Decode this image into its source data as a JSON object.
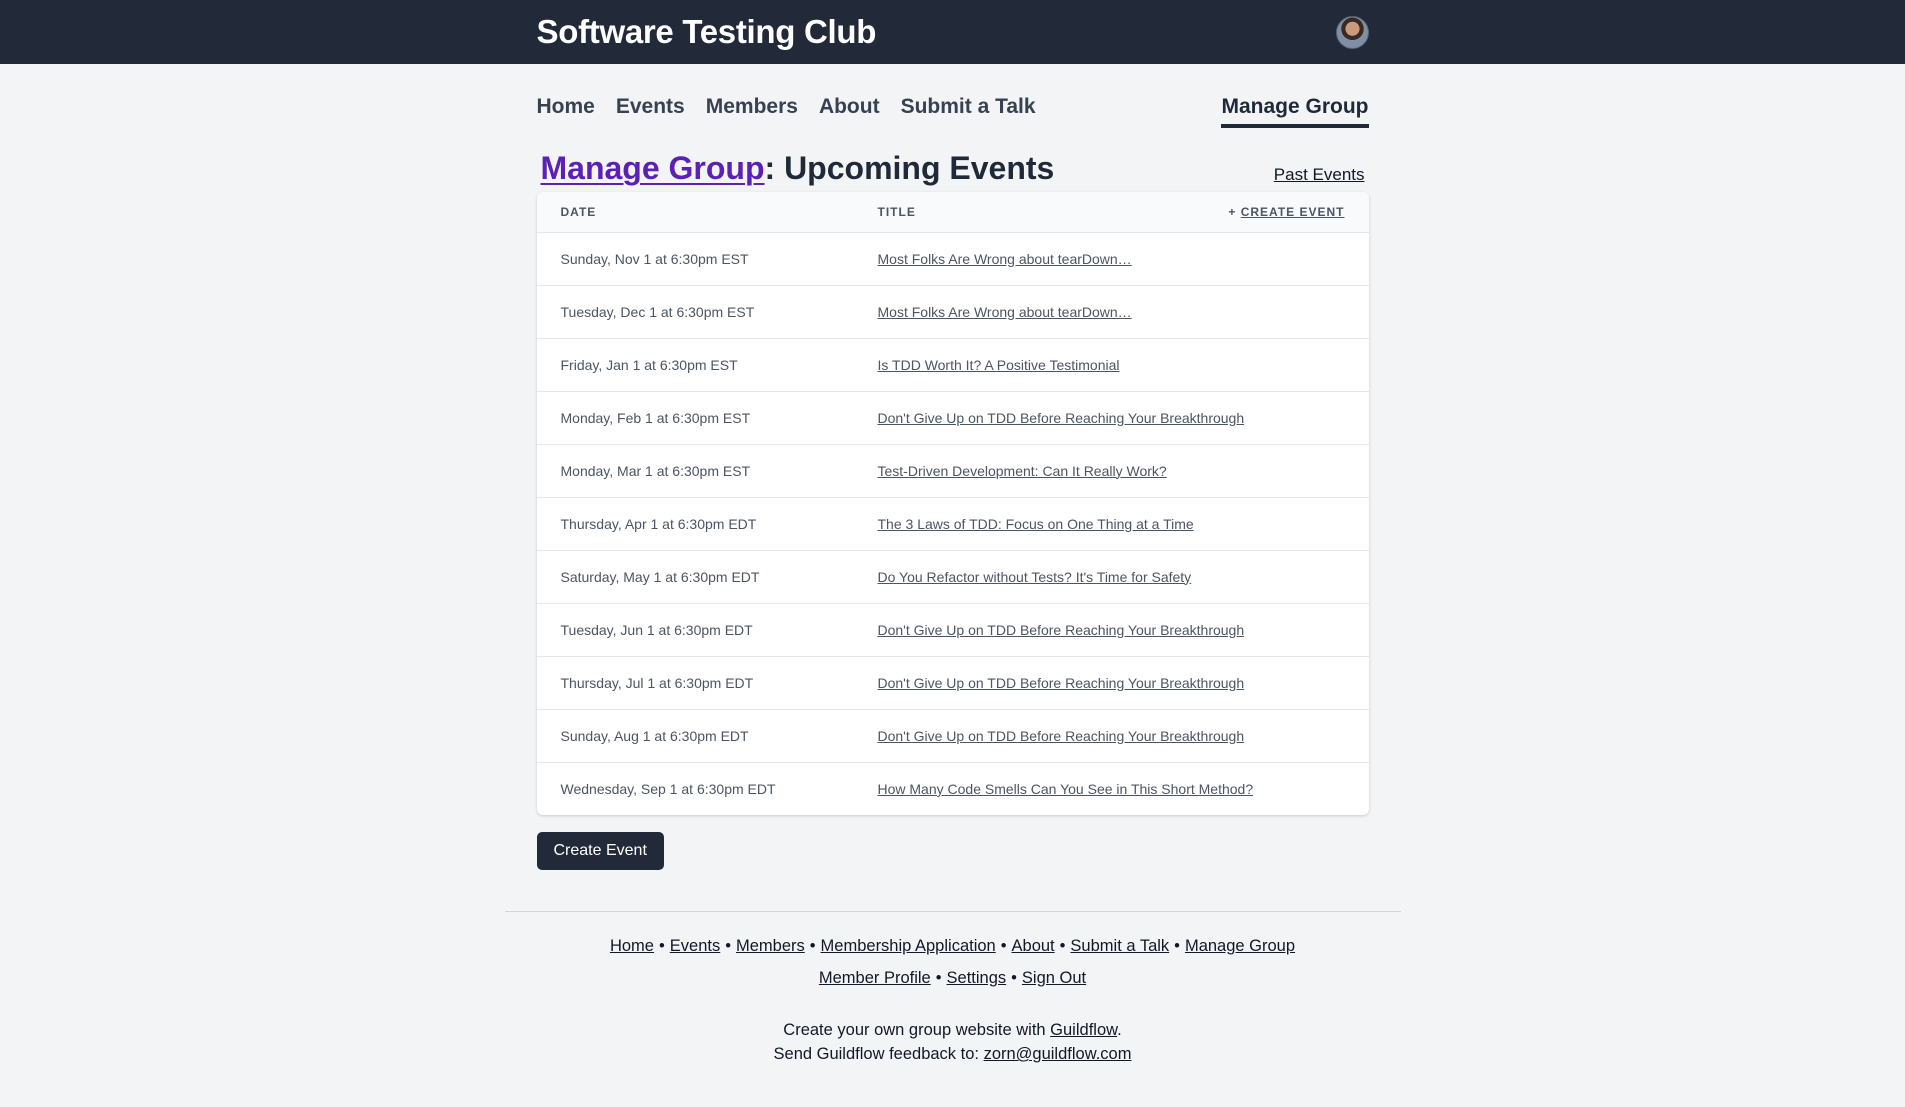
{
  "header": {
    "site_title": "Software Testing Club",
    "avatar_icon": "user-avatar"
  },
  "nav": {
    "items": [
      {
        "label": "Home"
      },
      {
        "label": "Events"
      },
      {
        "label": "Members"
      },
      {
        "label": "About"
      },
      {
        "label": "Submit a Talk"
      }
    ],
    "active_label": "Manage Group"
  },
  "page": {
    "title_link": "Manage Group",
    "title_rest": ": Upcoming Events",
    "past_events_label": "Past Events"
  },
  "table": {
    "headers": {
      "date": "DATE",
      "title": "TITLE",
      "create_prefix": "+ ",
      "create_label": "CREATE EVENT"
    },
    "rows": [
      {
        "date": "Sunday, Nov 1 at 6:30pm EST",
        "title": "Most Folks Are Wrong about tearDown…"
      },
      {
        "date": "Tuesday, Dec 1 at 6:30pm EST",
        "title": "Most Folks Are Wrong about tearDown…"
      },
      {
        "date": "Friday, Jan 1 at 6:30pm EST",
        "title": "Is TDD Worth It? A Positive Testimonial"
      },
      {
        "date": "Monday, Feb 1 at 6:30pm EST",
        "title": "Don't Give Up on TDD Before Reaching Your Breakthrough"
      },
      {
        "date": "Monday, Mar 1 at 6:30pm EST",
        "title": "Test-Driven Development: Can It Really Work?"
      },
      {
        "date": "Thursday, Apr 1 at 6:30pm EDT",
        "title": "The 3 Laws of TDD: Focus on One Thing at a Time"
      },
      {
        "date": "Saturday, May 1 at 6:30pm EDT",
        "title": "Do You Refactor without Tests? It's Time for Safety"
      },
      {
        "date": "Tuesday, Jun 1 at 6:30pm EDT",
        "title": "Don't Give Up on TDD Before Reaching Your Breakthrough"
      },
      {
        "date": "Thursday, Jul 1 at 6:30pm EDT",
        "title": "Don't Give Up on TDD Before Reaching Your Breakthrough"
      },
      {
        "date": "Sunday, Aug 1 at 6:30pm EDT",
        "title": "Don't Give Up on TDD Before Reaching Your Breakthrough"
      },
      {
        "date": "Wednesday, Sep 1 at 6:30pm EDT",
        "title": "How Many Code Smells Can You See in This Short Method?"
      }
    ]
  },
  "create_button_label": "Create Event",
  "footer": {
    "separator": "•",
    "links_row1": [
      "Home",
      "Events",
      "Members",
      "Membership Application",
      "About",
      "Submit a Talk",
      "Manage Group"
    ],
    "links_row2": [
      "Member Profile",
      "Settings",
      "Sign Out"
    ],
    "note1_prefix": "Create your own group website with ",
    "note1_link": "Guildflow",
    "note1_suffix": ".",
    "note2_prefix": "Send Guildflow feedback to: ",
    "note2_link": "zorn@guildflow.com"
  },
  "colors": {
    "topbar": "#222a3a",
    "title_link": "#5b21b6",
    "page_bg": "#f3f4f6"
  }
}
